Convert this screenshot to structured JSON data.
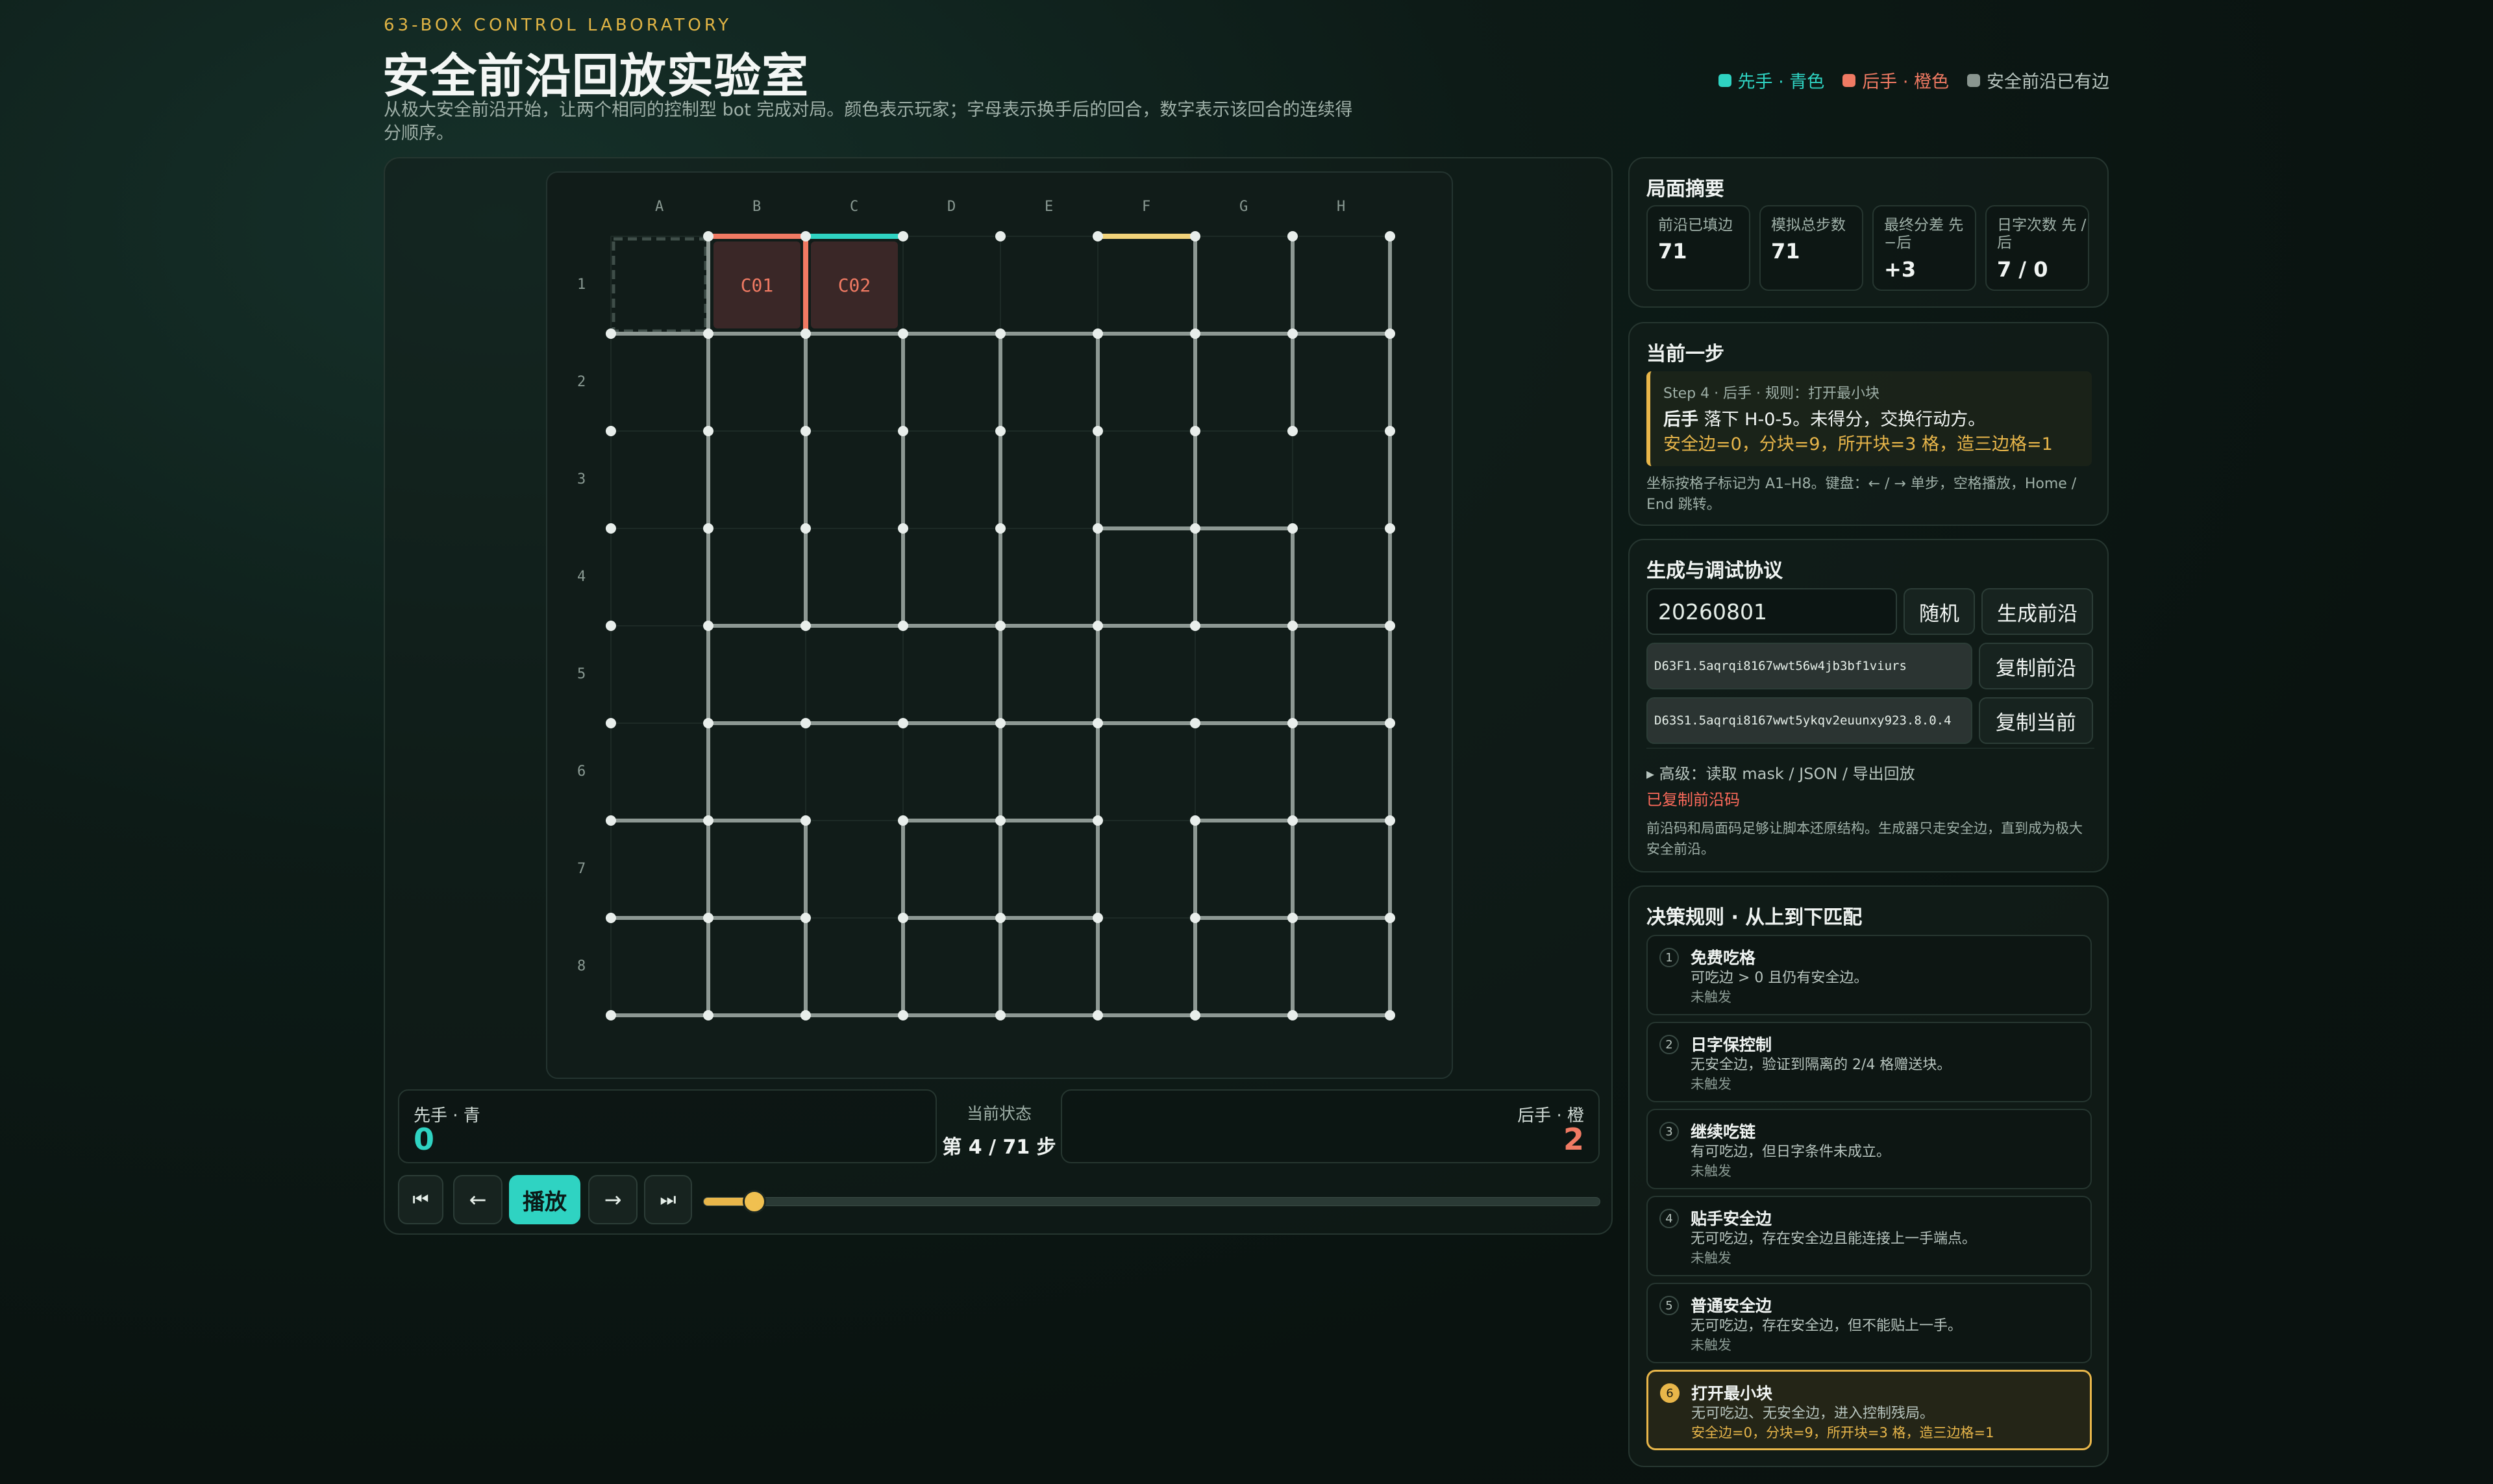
{
  "header": {
    "kicker": "63-BOX CONTROL LABORATORY",
    "title": "安全前沿回放实验室",
    "subtitle": "从极大安全前沿开始，让两个相同的控制型 bot 完成对局。颜色表示玩家；字母表示换手后的回合，数字表示该回合的连续得分顺序。"
  },
  "legend": [
    {
      "label": "先手 · 青色",
      "color": "#2fd3c2"
    },
    {
      "label": "后手 · 橙色",
      "color": "#f07a63"
    },
    {
      "label": "安全前沿已有边",
      "color": "#8a9690"
    }
  ],
  "board": {
    "columns": [
      "A",
      "B",
      "C",
      "D",
      "E",
      "F",
      "G",
      "H"
    ],
    "rows": [
      "1",
      "2",
      "3",
      "4",
      "5",
      "6",
      "7",
      "8"
    ],
    "claimed_boxes": [
      {
        "cell": "B1",
        "label": "C01"
      },
      {
        "cell": "C1",
        "label": "C02"
      }
    ],
    "colors": {
      "first": "#2fd3c2",
      "second": "#f07a63",
      "current": "#f2d37a",
      "frontier": "#8d9893"
    }
  },
  "players": {
    "first": {
      "label": "先手 · 青",
      "score": "0"
    },
    "second": {
      "label": "后手 · 橙",
      "score": "2"
    }
  },
  "status": {
    "label": "当前状态",
    "value": "第 4 / 71 步",
    "step": 4,
    "total": 71
  },
  "controls": {
    "first": "⏮",
    "prev": "←",
    "play": "播放",
    "next": "→",
    "last": "⏭"
  },
  "summary": {
    "title": "局面摘要",
    "stats": [
      {
        "label": "前沿已填边",
        "value": "71"
      },
      {
        "label": "模拟总步数",
        "value": "71"
      },
      {
        "label": "最终分差 先−后",
        "value": "+3"
      },
      {
        "label": "日字次数 先 / 后",
        "value": "7 / 0"
      }
    ]
  },
  "current_step": {
    "title": "当前一步",
    "meta": "Step 4 · 后手 · 规则：打开最小块",
    "player": "后手",
    "action": " 落下 H-0-5。未得分，交换行动方。",
    "detail": "安全边=0，分块=9，所开块=3 格，造三边格=1",
    "hint": "坐标按格子标记为 A1–H8。键盘：← / → 单步，空格播放，Home / End 跳转。"
  },
  "protocol": {
    "title": "生成与调试协议",
    "seed": "20260801",
    "random_btn": "随机",
    "generate_btn": "生成前沿",
    "frontier_code": "D63F1.5aqrqi8167wwt56w4jb3bf1viurs",
    "copy_frontier_btn": "复制前沿",
    "state_code": "D63S1.5aqrqi8167wwt5ykqv2euunxy923.8.0.4",
    "copy_state_btn": "复制当前",
    "advanced": "▸ 高级：读取 mask / JSON / 导出回放",
    "copied": "已复制前沿码",
    "note": "前沿码和局面码足够让脚本还原结构。生成器只走安全边，直到成为极大安全前沿。"
  },
  "rules": {
    "title": "决策规则 · 从上到下匹配",
    "items": [
      {
        "num": "1",
        "name": "免费吃格",
        "desc": "可吃边 > 0 且仍有安全边。",
        "state": "未触发"
      },
      {
        "num": "2",
        "name": "日字保控制",
        "desc": "无安全边，验证到隔离的 2/4 格赠送块。",
        "state": "未触发"
      },
      {
        "num": "3",
        "name": "继续吃链",
        "desc": "有可吃边，但日字条件未成立。",
        "state": "未触发"
      },
      {
        "num": "4",
        "name": "贴手安全边",
        "desc": "无可吃边，存在安全边且能连接上一手端点。",
        "state": "未触发"
      },
      {
        "num": "5",
        "name": "普通安全边",
        "desc": "无可吃边，存在安全边，但不能贴上一手。",
        "state": "未触发"
      },
      {
        "num": "6",
        "name": "打开最小块",
        "desc": "无可吃边、无安全边，进入控制残局。",
        "state": "安全边=0，分块=9，所开块=3 格，造三边格=1"
      }
    ]
  }
}
